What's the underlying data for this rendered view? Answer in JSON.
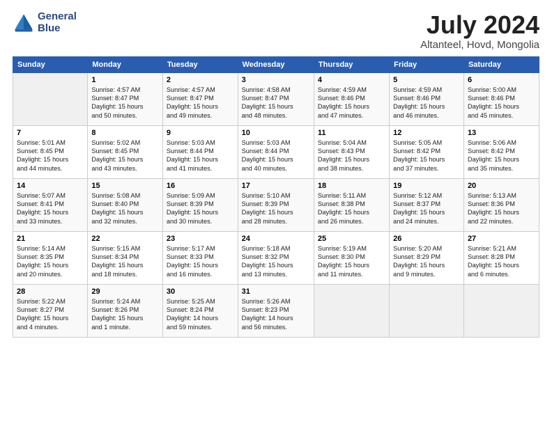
{
  "logo": {
    "line1": "General",
    "line2": "Blue"
  },
  "title": "July 2024",
  "subtitle": "Altanteel, Hovd, Mongolia",
  "header_days": [
    "Sunday",
    "Monday",
    "Tuesday",
    "Wednesday",
    "Thursday",
    "Friday",
    "Saturday"
  ],
  "weeks": [
    [
      {
        "num": "",
        "sunrise": "",
        "sunset": "",
        "daylight": ""
      },
      {
        "num": "1",
        "sunrise": "Sunrise: 4:57 AM",
        "sunset": "Sunset: 8:47 PM",
        "daylight": "Daylight: 15 hours and 50 minutes."
      },
      {
        "num": "2",
        "sunrise": "Sunrise: 4:57 AM",
        "sunset": "Sunset: 8:47 PM",
        "daylight": "Daylight: 15 hours and 49 minutes."
      },
      {
        "num": "3",
        "sunrise": "Sunrise: 4:58 AM",
        "sunset": "Sunset: 8:47 PM",
        "daylight": "Daylight: 15 hours and 48 minutes."
      },
      {
        "num": "4",
        "sunrise": "Sunrise: 4:59 AM",
        "sunset": "Sunset: 8:46 PM",
        "daylight": "Daylight: 15 hours and 47 minutes."
      },
      {
        "num": "5",
        "sunrise": "Sunrise: 4:59 AM",
        "sunset": "Sunset: 8:46 PM",
        "daylight": "Daylight: 15 hours and 46 minutes."
      },
      {
        "num": "6",
        "sunrise": "Sunrise: 5:00 AM",
        "sunset": "Sunset: 8:46 PM",
        "daylight": "Daylight: 15 hours and 45 minutes."
      }
    ],
    [
      {
        "num": "7",
        "sunrise": "Sunrise: 5:01 AM",
        "sunset": "Sunset: 8:45 PM",
        "daylight": "Daylight: 15 hours and 44 minutes."
      },
      {
        "num": "8",
        "sunrise": "Sunrise: 5:02 AM",
        "sunset": "Sunset: 8:45 PM",
        "daylight": "Daylight: 15 hours and 43 minutes."
      },
      {
        "num": "9",
        "sunrise": "Sunrise: 5:03 AM",
        "sunset": "Sunset: 8:44 PM",
        "daylight": "Daylight: 15 hours and 41 minutes."
      },
      {
        "num": "10",
        "sunrise": "Sunrise: 5:03 AM",
        "sunset": "Sunset: 8:44 PM",
        "daylight": "Daylight: 15 hours and 40 minutes."
      },
      {
        "num": "11",
        "sunrise": "Sunrise: 5:04 AM",
        "sunset": "Sunset: 8:43 PM",
        "daylight": "Daylight: 15 hours and 38 minutes."
      },
      {
        "num": "12",
        "sunrise": "Sunrise: 5:05 AM",
        "sunset": "Sunset: 8:42 PM",
        "daylight": "Daylight: 15 hours and 37 minutes."
      },
      {
        "num": "13",
        "sunrise": "Sunrise: 5:06 AM",
        "sunset": "Sunset: 8:42 PM",
        "daylight": "Daylight: 15 hours and 35 minutes."
      }
    ],
    [
      {
        "num": "14",
        "sunrise": "Sunrise: 5:07 AM",
        "sunset": "Sunset: 8:41 PM",
        "daylight": "Daylight: 15 hours and 33 minutes."
      },
      {
        "num": "15",
        "sunrise": "Sunrise: 5:08 AM",
        "sunset": "Sunset: 8:40 PM",
        "daylight": "Daylight: 15 hours and 32 minutes."
      },
      {
        "num": "16",
        "sunrise": "Sunrise: 5:09 AM",
        "sunset": "Sunset: 8:39 PM",
        "daylight": "Daylight: 15 hours and 30 minutes."
      },
      {
        "num": "17",
        "sunrise": "Sunrise: 5:10 AM",
        "sunset": "Sunset: 8:39 PM",
        "daylight": "Daylight: 15 hours and 28 minutes."
      },
      {
        "num": "18",
        "sunrise": "Sunrise: 5:11 AM",
        "sunset": "Sunset: 8:38 PM",
        "daylight": "Daylight: 15 hours and 26 minutes."
      },
      {
        "num": "19",
        "sunrise": "Sunrise: 5:12 AM",
        "sunset": "Sunset: 8:37 PM",
        "daylight": "Daylight: 15 hours and 24 minutes."
      },
      {
        "num": "20",
        "sunrise": "Sunrise: 5:13 AM",
        "sunset": "Sunset: 8:36 PM",
        "daylight": "Daylight: 15 hours and 22 minutes."
      }
    ],
    [
      {
        "num": "21",
        "sunrise": "Sunrise: 5:14 AM",
        "sunset": "Sunset: 8:35 PM",
        "daylight": "Daylight: 15 hours and 20 minutes."
      },
      {
        "num": "22",
        "sunrise": "Sunrise: 5:15 AM",
        "sunset": "Sunset: 8:34 PM",
        "daylight": "Daylight: 15 hours and 18 minutes."
      },
      {
        "num": "23",
        "sunrise": "Sunrise: 5:17 AM",
        "sunset": "Sunset: 8:33 PM",
        "daylight": "Daylight: 15 hours and 16 minutes."
      },
      {
        "num": "24",
        "sunrise": "Sunrise: 5:18 AM",
        "sunset": "Sunset: 8:32 PM",
        "daylight": "Daylight: 15 hours and 13 minutes."
      },
      {
        "num": "25",
        "sunrise": "Sunrise: 5:19 AM",
        "sunset": "Sunset: 8:30 PM",
        "daylight": "Daylight: 15 hours and 11 minutes."
      },
      {
        "num": "26",
        "sunrise": "Sunrise: 5:20 AM",
        "sunset": "Sunset: 8:29 PM",
        "daylight": "Daylight: 15 hours and 9 minutes."
      },
      {
        "num": "27",
        "sunrise": "Sunrise: 5:21 AM",
        "sunset": "Sunset: 8:28 PM",
        "daylight": "Daylight: 15 hours and 6 minutes."
      }
    ],
    [
      {
        "num": "28",
        "sunrise": "Sunrise: 5:22 AM",
        "sunset": "Sunset: 8:27 PM",
        "daylight": "Daylight: 15 hours and 4 minutes."
      },
      {
        "num": "29",
        "sunrise": "Sunrise: 5:24 AM",
        "sunset": "Sunset: 8:26 PM",
        "daylight": "Daylight: 15 hours and 1 minute."
      },
      {
        "num": "30",
        "sunrise": "Sunrise: 5:25 AM",
        "sunset": "Sunset: 8:24 PM",
        "daylight": "Daylight: 14 hours and 59 minutes."
      },
      {
        "num": "31",
        "sunrise": "Sunrise: 5:26 AM",
        "sunset": "Sunset: 8:23 PM",
        "daylight": "Daylight: 14 hours and 56 minutes."
      },
      {
        "num": "",
        "sunrise": "",
        "sunset": "",
        "daylight": ""
      },
      {
        "num": "",
        "sunrise": "",
        "sunset": "",
        "daylight": ""
      },
      {
        "num": "",
        "sunrise": "",
        "sunset": "",
        "daylight": ""
      }
    ]
  ]
}
